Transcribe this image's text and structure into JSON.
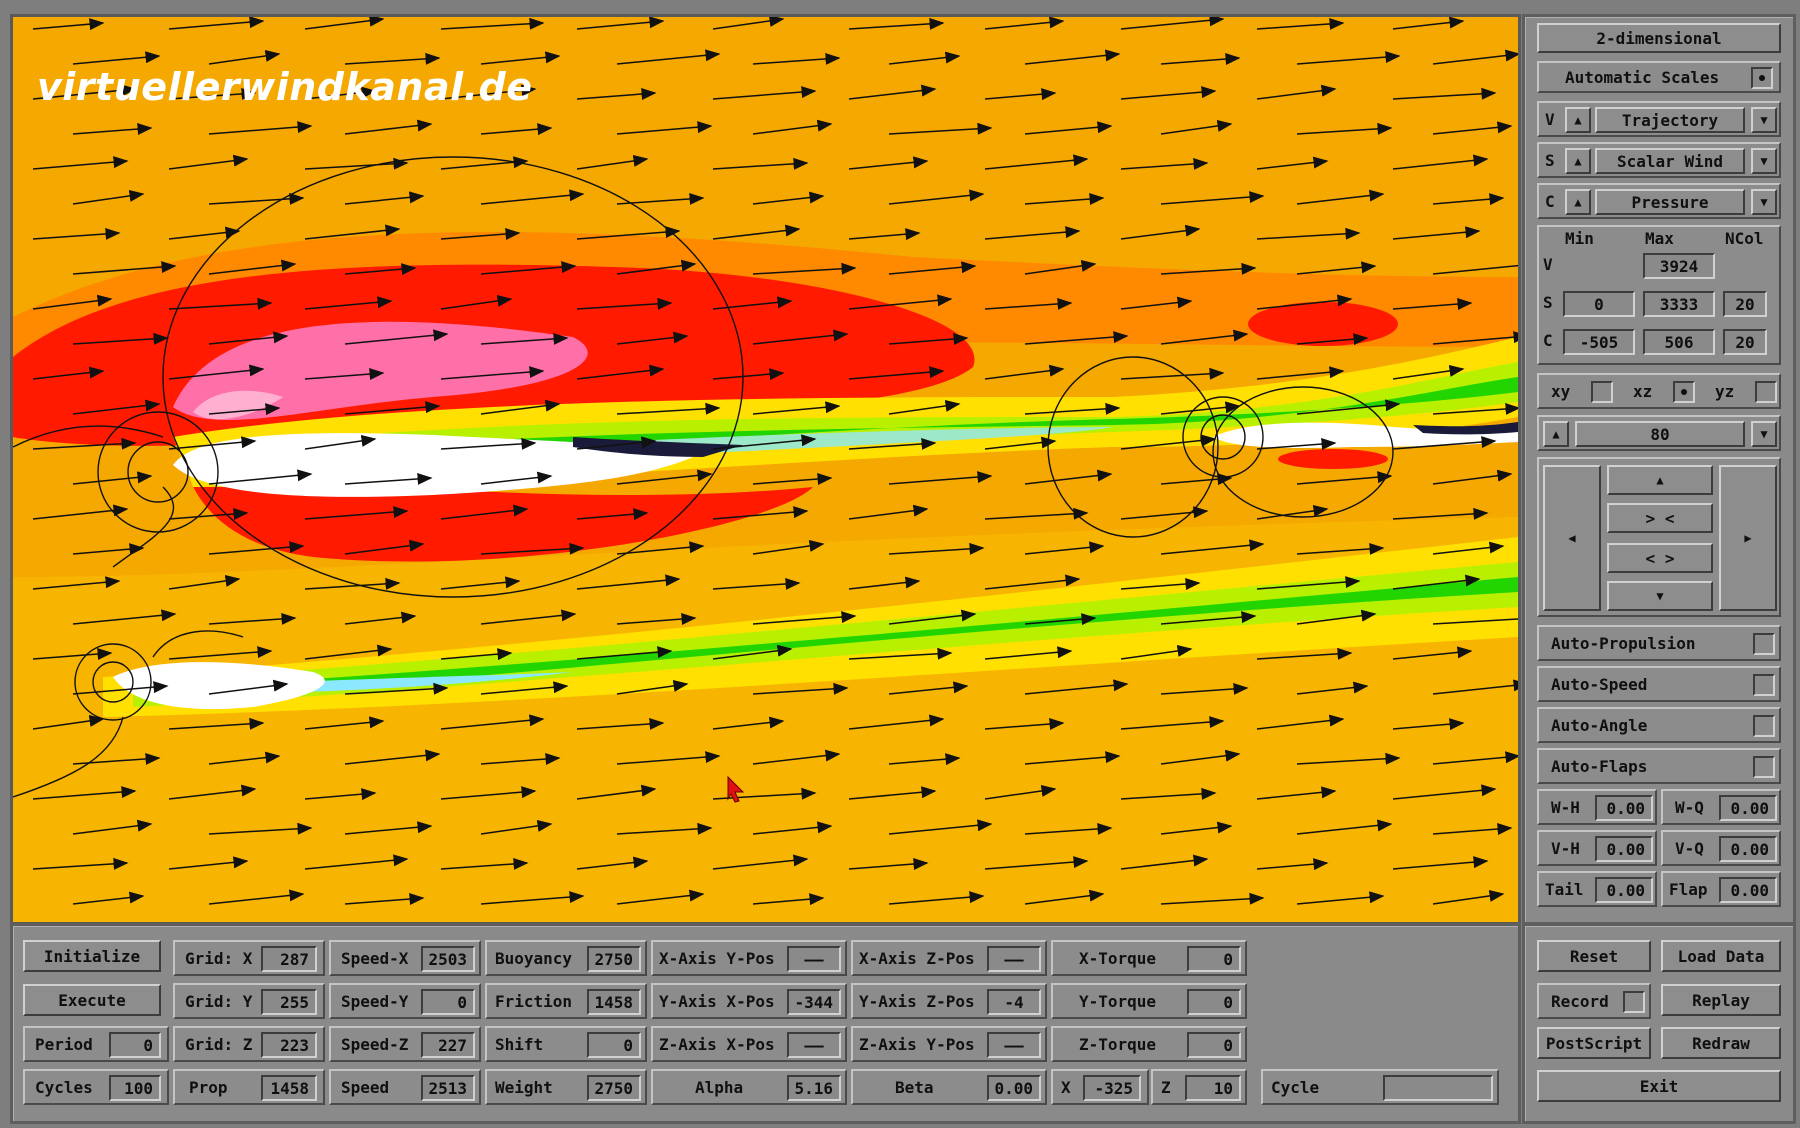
{
  "watermark": "virtuellerwindkanal.de",
  "right_panel": {
    "mode_button": "2-dimensional",
    "auto_scales_label": "Automatic Scales",
    "rows": [
      {
        "letter": "V",
        "label": "Trajectory"
      },
      {
        "letter": "S",
        "label": "Scalar Wind"
      },
      {
        "letter": "C",
        "label": "Pressure"
      }
    ],
    "range_headers": {
      "min": "Min",
      "max": "Max",
      "ncol": "NCol"
    },
    "range_rows": [
      {
        "letter": "V",
        "min": "",
        "max": "3924",
        "ncol": ""
      },
      {
        "letter": "S",
        "min": "0",
        "max": "3333",
        "ncol": "20"
      },
      {
        "letter": "C",
        "min": "-505",
        "max": "506",
        "ncol": "20"
      }
    ],
    "planes": [
      "xy",
      "xz",
      "yz"
    ],
    "plane_selected": "xz",
    "slice_value": "80",
    "nav": {
      "up": "▲",
      "zoom_in": "> <",
      "zoom_out": "< >",
      "down": "▼",
      "left": "◀",
      "right": "▶"
    },
    "toggles": [
      "Auto-Propulsion",
      "Auto-Speed",
      "Auto-Angle",
      "Auto-Flaps"
    ],
    "wv": [
      {
        "label": "W-H",
        "value": "0.00"
      },
      {
        "label": "W-Q",
        "value": "0.00"
      },
      {
        "label": "V-H",
        "value": "0.00"
      },
      {
        "label": "V-Q",
        "value": "0.00"
      },
      {
        "label": "Tail",
        "value": "0.00"
      },
      {
        "label": "Flap",
        "value": "0.00"
      }
    ]
  },
  "bottom": {
    "initialize": "Initialize",
    "execute": "Execute",
    "period": {
      "label": "Period",
      "value": "0"
    },
    "cycles": {
      "label": "Cycles",
      "value": "100"
    },
    "grid_x": {
      "label": "Grid: X",
      "value": "287"
    },
    "grid_y": {
      "label": "Grid: Y",
      "value": "255"
    },
    "grid_z": {
      "label": "Grid: Z",
      "value": "223"
    },
    "prop": {
      "label": "Prop",
      "value": "1458"
    },
    "speed_x": {
      "label": "Speed-X",
      "value": "2503"
    },
    "speed_y": {
      "label": "Speed-Y",
      "value": "0"
    },
    "speed_z": {
      "label": "Speed-Z",
      "value": "227"
    },
    "speed": {
      "label": "Speed",
      "value": "2513"
    },
    "buoyancy": {
      "label": "Buoyancy",
      "value": "2750"
    },
    "friction": {
      "label": "Friction",
      "value": "1458"
    },
    "shift": {
      "label": "Shift",
      "value": "0"
    },
    "weight": {
      "label": "Weight",
      "value": "2750"
    },
    "xaxis_ypos": {
      "label": "X-Axis Y-Pos",
      "value": "——"
    },
    "yaxis_xpos": {
      "label": "Y-Axis X-Pos",
      "value": "-344"
    },
    "zaxis_xpos": {
      "label": "Z-Axis X-Pos",
      "value": "——"
    },
    "alpha": {
      "label": "Alpha",
      "value": "5.16"
    },
    "xaxis_zpos": {
      "label": "X-Axis Z-Pos",
      "value": "——"
    },
    "yaxis_zpos": {
      "label": "Y-Axis Z-Pos",
      "value": "-4"
    },
    "zaxis_ypos": {
      "label": "Z-Axis Y-Pos",
      "value": "——"
    },
    "beta": {
      "label": "Beta",
      "value": "0.00"
    },
    "x_torque": {
      "label": "X-Torque",
      "value": "0"
    },
    "y_torque": {
      "label": "Y-Torque",
      "value": "0"
    },
    "z_torque": {
      "label": "Z-Torque",
      "value": "0"
    },
    "x": {
      "label": "X",
      "value": "-325"
    },
    "z": {
      "label": "Z",
      "value": "10"
    },
    "cycle": {
      "label": "Cycle"
    },
    "reset": "Reset",
    "load_data": "Load Data",
    "record": "Record",
    "replay": "Replay",
    "postscript": "PostScript",
    "redraw": "Redraw",
    "exit": "Exit"
  },
  "colors": {
    "bg": "#f5a800",
    "red": "#ff1a00",
    "pink": "#ff6fa8",
    "orange": "#ff7a00",
    "yellow": "#ffe000",
    "green": "#22d400",
    "panel": "#8a8a8a"
  },
  "icons": [
    "up-triangle-icon",
    "down-triangle-icon",
    "left-arrow-icon",
    "right-arrow-icon",
    "cursor-icon"
  ]
}
